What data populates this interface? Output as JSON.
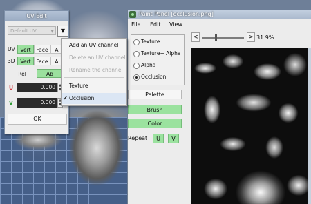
{
  "uv_edit": {
    "title": "UV Edit",
    "channel_placeholder": "Default UV",
    "channel_menu_icon": "▼",
    "uv_row": {
      "label": "UV",
      "vert": "Vert",
      "face": "Face",
      "a": "A"
    },
    "three_d_row": {
      "label": "3D",
      "vert": "Vert",
      "face": "Face",
      "a": "A"
    },
    "rel_label": "Rel",
    "ab_label": "Ab",
    "u": {
      "label": "U",
      "value": "0.000"
    },
    "v": {
      "label": "V",
      "value": "0.000"
    },
    "ok_label": "OK"
  },
  "context_menu": {
    "items": [
      {
        "label": "Add an UV channel",
        "enabled": true
      },
      {
        "label": "Delete an UV channel",
        "enabled": false
      },
      {
        "label": "Rename the channel",
        "enabled": false
      },
      {
        "label": "Texture",
        "enabled": true
      },
      {
        "label": "Occlusion",
        "enabled": true,
        "checked": true,
        "hovered": true
      }
    ]
  },
  "paint_panel": {
    "title": "Paint Panel [occlusion.png]",
    "menu": {
      "file": "File",
      "edit": "Edit",
      "view": "View"
    },
    "modes": [
      {
        "label": "Texture",
        "selected": false
      },
      {
        "label": "Texture+ Alpha",
        "selected": false
      },
      {
        "label": "Alpha",
        "selected": false
      },
      {
        "label": "Occlusion",
        "selected": true
      }
    ],
    "buttons": {
      "palette": "Palette",
      "brush": "Brush",
      "color": "Color"
    },
    "repeat": {
      "label": "Repeat",
      "u": "U",
      "v": "V"
    },
    "zoom": {
      "decrease": "<",
      "increase": ">",
      "value": "31.9%",
      "level": 0.319
    }
  },
  "colors": {
    "toggle_on": "#9be09e",
    "titlebar": "#9aabc2",
    "dark_field": "#2b2b2b"
  }
}
